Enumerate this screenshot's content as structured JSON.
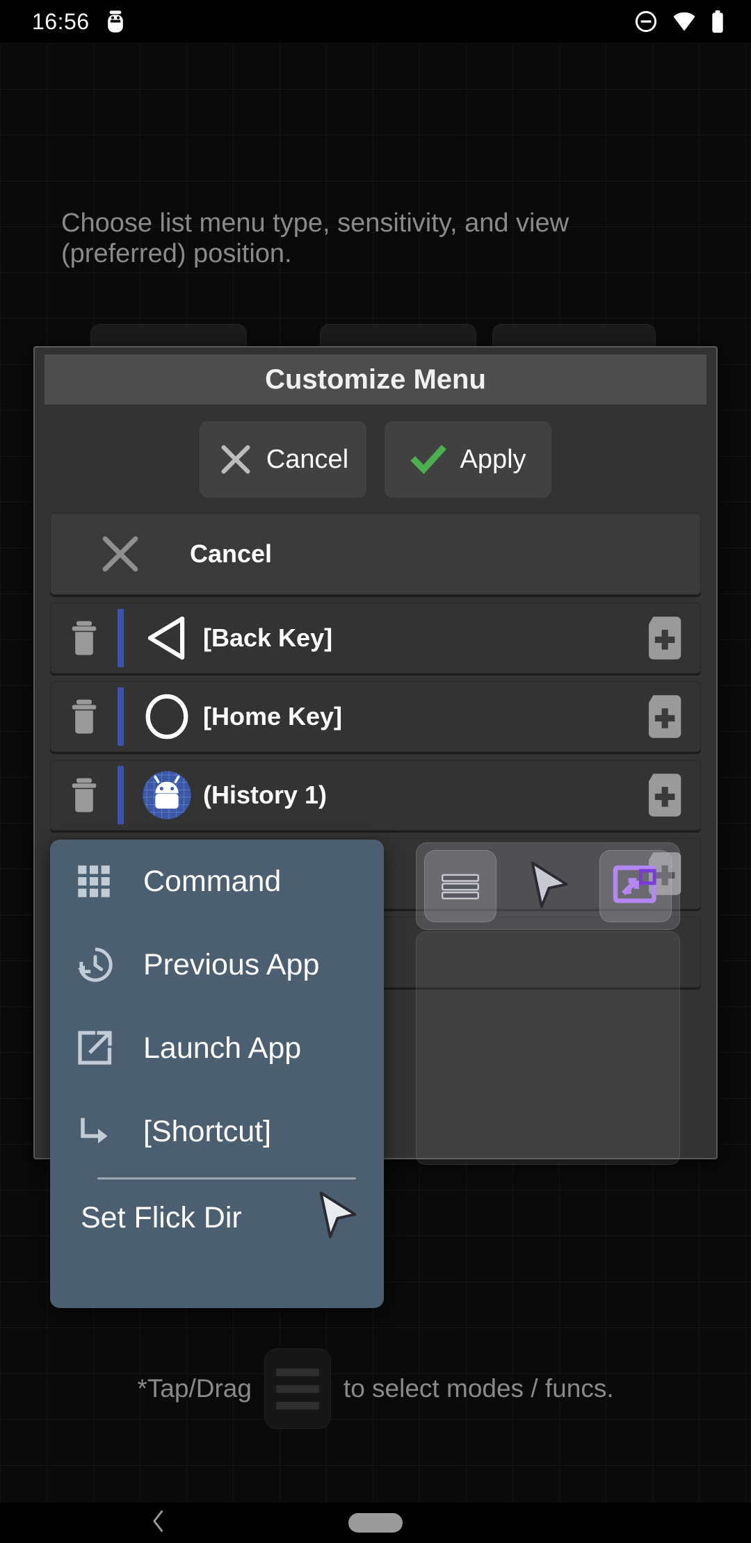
{
  "status_bar": {
    "time": "16:56",
    "left_icons": [
      "android-battery-saver-icon"
    ],
    "right_icons": [
      "do-not-disturb-icon",
      "wifi-icon",
      "battery-icon"
    ]
  },
  "background": {
    "description_line1": "Choose list menu type, sensitivity, and view",
    "description_line2": "(preferred) position."
  },
  "dialog": {
    "title": "Customize Menu",
    "buttons": [
      {
        "label": "Cancel",
        "icon": "close-x-icon",
        "color": "#b8b8b8"
      },
      {
        "label": "Apply",
        "icon": "check-icon",
        "color": "#4CAF50"
      }
    ],
    "rows": [
      {
        "label": "Cancel",
        "icon": "close-x-icon",
        "type": "cancel",
        "has_trash": false,
        "has_add": false,
        "has_bar": false
      },
      {
        "label": "[Back Key]",
        "icon": "back-triangle-icon",
        "type": "item",
        "has_trash": true,
        "has_add": true,
        "has_bar": true
      },
      {
        "label": "[Home Key]",
        "icon": "home-circle-icon",
        "type": "item",
        "has_trash": true,
        "has_add": true,
        "has_bar": true
      },
      {
        "label": "(History 1)",
        "icon": "android-app-icon",
        "type": "item",
        "has_trash": true,
        "has_add": true,
        "has_bar": true
      },
      {
        "label": "",
        "icon": "",
        "type": "item",
        "has_trash": true,
        "has_add": true,
        "has_bar": true
      },
      {
        "label": "",
        "icon": "",
        "type": "item",
        "has_trash": true,
        "has_add": true,
        "has_bar": true
      }
    ]
  },
  "popup_menu": {
    "items": [
      {
        "label": "Command",
        "icon": "grid-apps-icon"
      },
      {
        "label": "Previous App",
        "icon": "history-clock-icon"
      },
      {
        "label": "Launch App",
        "icon": "open-in-new-icon"
      },
      {
        "label": "[Shortcut]",
        "icon": "subdirectory-arrow-icon"
      }
    ],
    "footer": {
      "label": "Set Flick Dir",
      "icon": "cursor-pointer-icon"
    }
  },
  "floating_toolbar": {
    "icons": [
      "list-menu-icon",
      "cursor-pointer-icon",
      "resize-window-icon"
    ],
    "accent_color": "#b388f5"
  },
  "hint": {
    "prefix": "*Tap/Drag",
    "suffix": "to select modes / funcs.",
    "icon": "list-menu-icon"
  },
  "nav_bar": {
    "back_icon": "chevron-left-icon",
    "home_icon": "home-pill-icon"
  },
  "colors": {
    "dialog_bg": "#333333",
    "dialog_title_bg": "#4d4d4d",
    "popup_bg": "#4c5f70",
    "accent_blue": "#3b51b8",
    "apply_green": "#4CAF50",
    "purple": "#b388f5"
  }
}
